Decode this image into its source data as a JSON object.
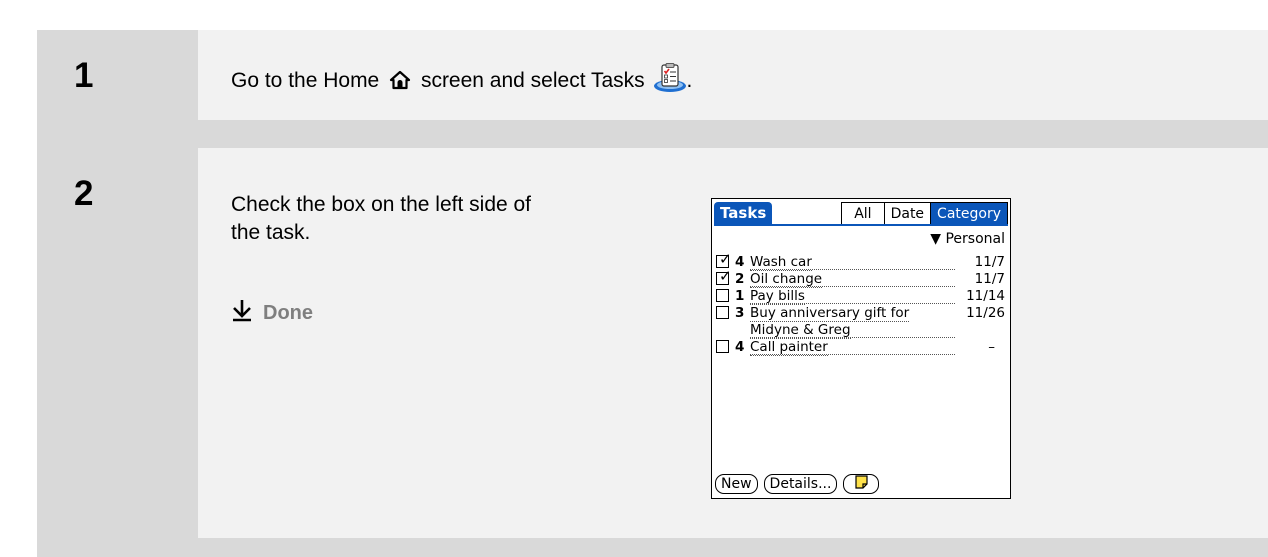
{
  "steps": [
    {
      "number": "1",
      "text_before": "Go to the Home",
      "text_middle": "screen and select Tasks",
      "text_after": "."
    },
    {
      "number": "2",
      "text_line1": "Check the box on the left side of",
      "text_line2": "the task.",
      "done_label": "Done"
    }
  ],
  "palm": {
    "app_title": "Tasks",
    "tabs": [
      "All",
      "Date",
      "Category"
    ],
    "active_tab": "Category",
    "category": "Personal",
    "tasks": [
      {
        "checked": true,
        "priority": "4",
        "desc": "Wash car",
        "due": "11/7"
      },
      {
        "checked": true,
        "priority": "2",
        "desc": "Oil change",
        "due": "11/7"
      },
      {
        "checked": false,
        "priority": "1",
        "desc": "Pay bills",
        "due": "11/14"
      },
      {
        "checked": false,
        "priority": "3",
        "desc": "Buy anniversary gift for",
        "desc2": "Midyne & Greg",
        "due": "11/26"
      },
      {
        "checked": false,
        "priority": "4",
        "desc": "Call painter",
        "due": "–"
      }
    ],
    "buttons": {
      "new": "New",
      "details": "Details..."
    }
  },
  "icons": {
    "home": "home-icon",
    "tasks": "tasks-app-icon",
    "done": "down-arrow-icon",
    "note": "note-icon"
  },
  "colors": {
    "accent": "#0b56b9",
    "outer_bg": "#d9d9d9",
    "cell_bg": "#f2f2f2",
    "done_text": "#7f7f7f"
  }
}
